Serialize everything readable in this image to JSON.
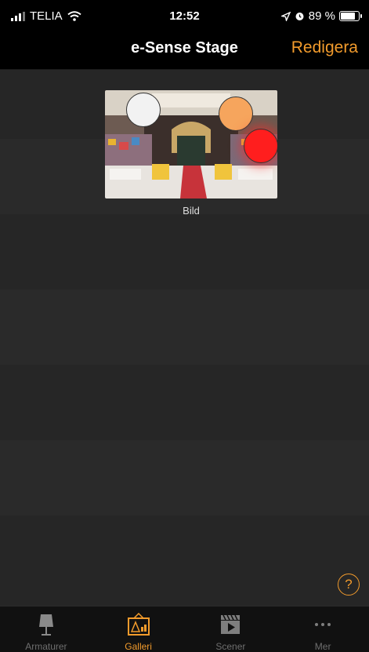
{
  "status_bar": {
    "carrier": "TELIA",
    "time": "12:52",
    "battery": "89 %",
    "battery_level": 0.89
  },
  "navbar": {
    "title": "e-Sense Stage",
    "edit_label": "Redigera"
  },
  "gallery": {
    "items": [
      {
        "label": "Bild",
        "lights": [
          "#f2f2f2",
          "#f6a55d",
          "#ff1e1e"
        ]
      }
    ]
  },
  "help": {
    "label": "?"
  },
  "tab_bar": {
    "active": "Galleri",
    "tabs": [
      {
        "label": "Armaturer",
        "icon": "lamp-icon"
      },
      {
        "label": "Galleri",
        "icon": "gallery-icon"
      },
      {
        "label": "Scener",
        "icon": "scene-clapper-icon"
      },
      {
        "label": "Mer",
        "icon": "more-dots-icon"
      }
    ]
  },
  "colors": {
    "accent": "#f29b2c",
    "background": "#262626",
    "bar": "#000000"
  }
}
